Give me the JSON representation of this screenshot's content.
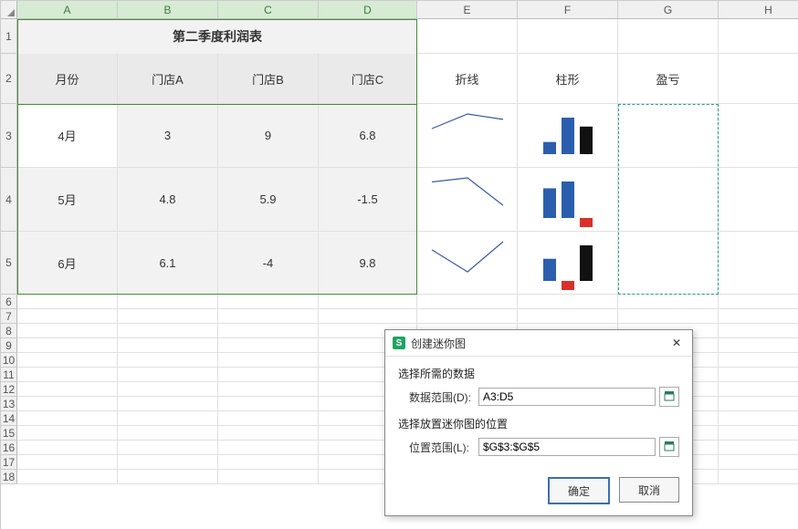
{
  "columns": [
    "A",
    "B",
    "C",
    "D",
    "E",
    "F",
    "G",
    "H"
  ],
  "rows": [
    "1",
    "2",
    "3",
    "4",
    "5",
    "6",
    "7",
    "8",
    "9",
    "10",
    "11",
    "12",
    "13",
    "14",
    "15",
    "16",
    "17",
    "18"
  ],
  "title_cell": "第二季度利润表",
  "header_row": {
    "c0": "月份",
    "c1": "门店A",
    "c2": "门店B",
    "c3": "门店C"
  },
  "header_efg": {
    "e": "折线",
    "f": "柱形",
    "g": "盈亏"
  },
  "data": [
    {
      "c0": "4月",
      "c1": "3",
      "c2": "9",
      "c3": "6.8"
    },
    {
      "c0": "5月",
      "c1": "4.8",
      "c2": "5.9",
      "c3": "-1.5"
    },
    {
      "c0": "6月",
      "c1": "6.1",
      "c2": "-4",
      "c3": "9.8"
    }
  ],
  "dialog": {
    "title": "创建迷你图",
    "sec1": "选择所需的数据",
    "lbl1": "数据范围(D):",
    "val1": "A3:D5",
    "sec2": "选择放置迷你图的位置",
    "lbl2": "位置范围(L):",
    "val2": "$G$3:$G$5",
    "ok": "确定",
    "cancel": "取消"
  },
  "chart_data": {
    "type": "sparklines",
    "rows": [
      {
        "label": "4月",
        "values": [
          3,
          9,
          6.8
        ]
      },
      {
        "label": "5月",
        "values": [
          4.8,
          5.9,
          -1.5
        ]
      },
      {
        "label": "6月",
        "values": [
          6.1,
          -4,
          9.8
        ]
      }
    ],
    "variants": [
      "line",
      "column",
      "winloss"
    ]
  }
}
